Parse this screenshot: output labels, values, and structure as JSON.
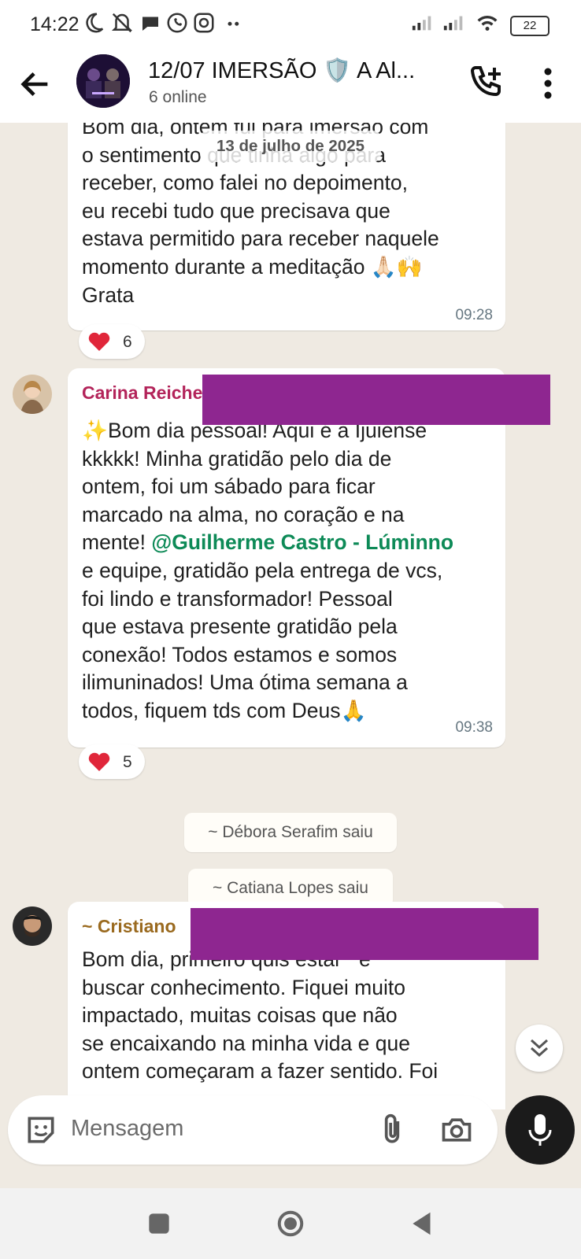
{
  "status_bar": {
    "time": "14:22",
    "battery": "22",
    "icons": [
      "moon-icon",
      "muted-icon",
      "chat-bubble-icon",
      "whatsapp-icon",
      "instagram-icon",
      "more-dots-icon",
      "signal-icon",
      "signal-icon",
      "wifi-icon",
      "battery-icon"
    ]
  },
  "header": {
    "title": "12/07 IMERSÃO 🛡️ A Al...",
    "subtitle": "6 online"
  },
  "chat": {
    "date_chip": "13 de julho de 2025",
    "messages": [
      {
        "lines": [
          "Bom dia, ontem fui para imersão com",
          "o sentimento que tinha algo para",
          "receber, como falei no depoimento,",
          "eu recebi tudo que precisava que",
          "estava permitido para receber naquele",
          "momento durante a meditação 🙏🏻🙌",
          "Grata"
        ],
        "time": "09:28",
        "reaction": {
          "emoji": "heart-icon",
          "count": "6"
        }
      },
      {
        "sender": "Carina Reiche",
        "sender_color": "#b3245a",
        "lines": [
          "✨Bom dia pessoal! Aqui é a Ijuiense",
          "kkkkk! Minha gratidão pelo dia de",
          "ontem, foi um sábado para ficar",
          "marcado na alma, no coração e na",
          "mente!",
          "e equipe, gratidão pela entrega de vcs,",
          "foi lindo e transformador! Pessoal",
          "que estava presente gratidão pela",
          "conexão! Todos estamos e somos",
          "ilimuninados! Uma ótima semana a",
          "todos, fiquem tds com Deus🙏"
        ],
        "mention": "@Guilherme Castro - Lúminno",
        "time": "09:38",
        "reaction": {
          "emoji": "heart-icon",
          "count": "5"
        }
      },
      {
        "sender": "~ Cristiano",
        "sender_color": "#9a6a1f",
        "lines": [
          "Bom dia, primeiro quis estar   e",
          "buscar conhecimento. Fiquei muito",
          "impactado, muitas coisas que não",
          "se encaixando na minha vida e que",
          "ontem começaram a fazer sentido. Foi"
        ]
      }
    ],
    "system_messages": [
      "~ Débora Serafim saiu",
      "~ Catiana Lopes saiu"
    ]
  },
  "composer": {
    "placeholder": "Mensagem"
  },
  "colors": {
    "chat_bg": "#efeae2",
    "bubble": "#ffffff",
    "mention": "#0d8a57",
    "redaction": "#8e2690"
  }
}
